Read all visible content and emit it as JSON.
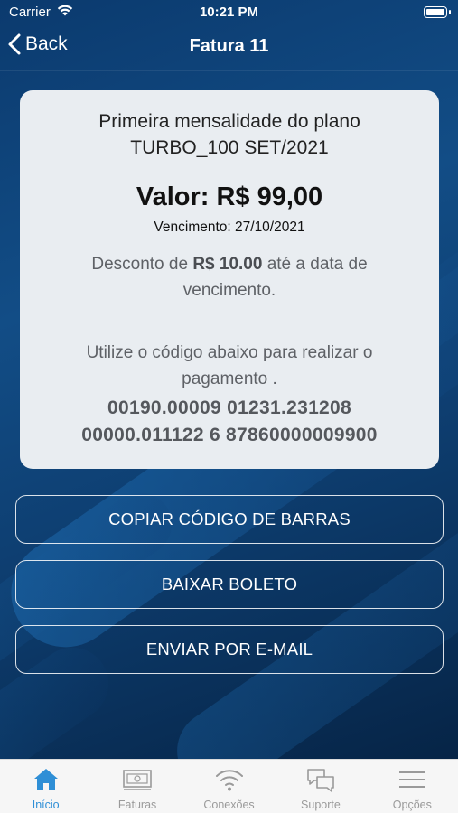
{
  "status_bar": {
    "carrier": "Carrier",
    "time": "10:21 PM"
  },
  "nav": {
    "back_label": "Back",
    "title": "Fatura 11"
  },
  "invoice": {
    "plan_line1": "Primeira mensalidade do plano",
    "plan_line2": "TURBO_100 SET/2021",
    "valor": "Valor: R$ 99,00",
    "vencimento": "Vencimento: 27/10/2021",
    "desconto_prefix": "Desconto de ",
    "desconto_amount": "R$ 10.00",
    "desconto_suffix": " até a data de vencimento.",
    "instrucao": "Utilize o código abaixo para realizar o pagamento .",
    "codigo_line1": "00190.00009 01231.231208",
    "codigo_line2": "00000.011122 6 87860000009900"
  },
  "actions": {
    "copy_barcode": "COPIAR CÓDIGO DE BARRAS",
    "download_boleto": "BAIXAR BOLETO",
    "send_email": "ENVIAR POR E-MAIL"
  },
  "tabs": [
    {
      "label": "Início",
      "icon": "home-icon",
      "active": true
    },
    {
      "label": "Faturas",
      "icon": "invoice-icon",
      "active": false
    },
    {
      "label": "Conexões",
      "icon": "wifi-icon",
      "active": false
    },
    {
      "label": "Suporte",
      "icon": "chat-icon",
      "active": false
    },
    {
      "label": "Opções",
      "icon": "menu-icon",
      "active": false
    }
  ],
  "colors": {
    "accent": "#2f8fd6",
    "background": "#0d3a66",
    "card": "#e9edf1"
  }
}
